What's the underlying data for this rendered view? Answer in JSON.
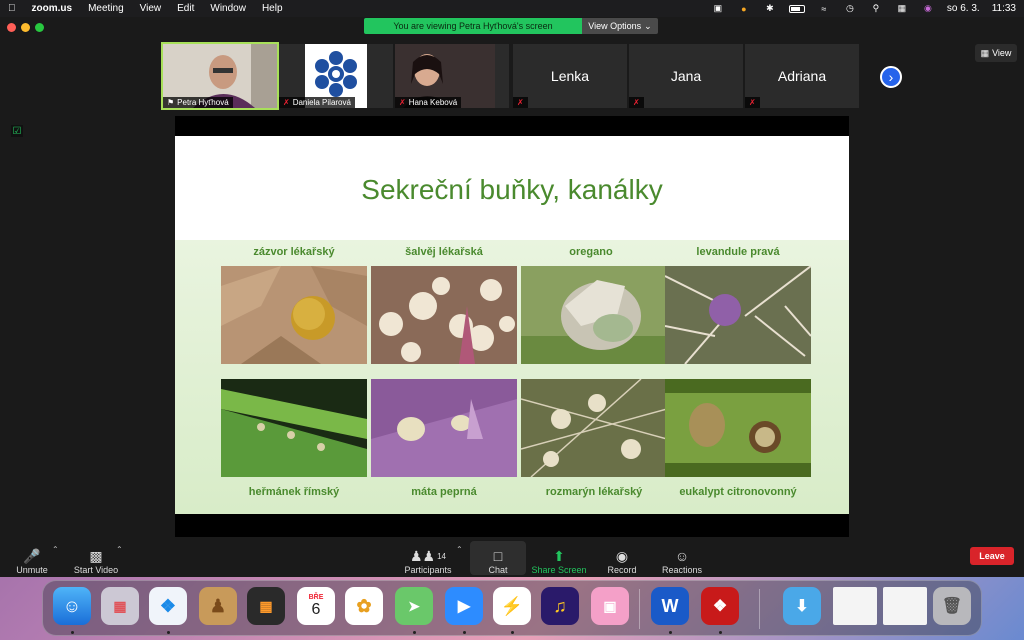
{
  "menubar": {
    "app_name": "zoom.us",
    "items": [
      "Meeting",
      "View",
      "Edit",
      "Window",
      "Help"
    ],
    "date": "so 6. 3.",
    "time": "11:33"
  },
  "window": {
    "banner": "You are viewing Petra Hyťhová's screen",
    "view_options": "View Options",
    "view_button": "View"
  },
  "participants_strip": [
    {
      "name": "Petra Hyťhová",
      "type": "video",
      "active": true
    },
    {
      "name": "Daniela Pilarová",
      "type": "logo"
    },
    {
      "name": "Hana Kebová",
      "type": "video"
    },
    {
      "name": "Lenka",
      "type": "name"
    },
    {
      "name": "Jana",
      "type": "name"
    },
    {
      "name": "Adriana",
      "type": "name"
    }
  ],
  "slide": {
    "title": "Sekreční buňky, kanálky",
    "top_captions": [
      "zázvor lékařský",
      "šalvěj lékařská",
      "oregano",
      "levandule pravá"
    ],
    "bottom_captions": [
      "heřmánek římský",
      "máta peprná",
      "rozmarýn lékařský",
      "eukalypt citronovonný"
    ]
  },
  "toolbar": {
    "unmute": "Unmute",
    "start_video": "Start Video",
    "participants": "Participants",
    "participants_count": "14",
    "chat": "Chat",
    "share_screen": "Share Screen",
    "record": "Record",
    "reactions": "Reactions",
    "leave": "Leave"
  },
  "dock": {
    "calendar_month": "BŘE",
    "calendar_day": "6"
  },
  "colors": {
    "banner_green": "#22c55e",
    "slide_green": "#4a8a2e",
    "leave_red": "#d9242a",
    "next_blue": "#2563eb"
  }
}
